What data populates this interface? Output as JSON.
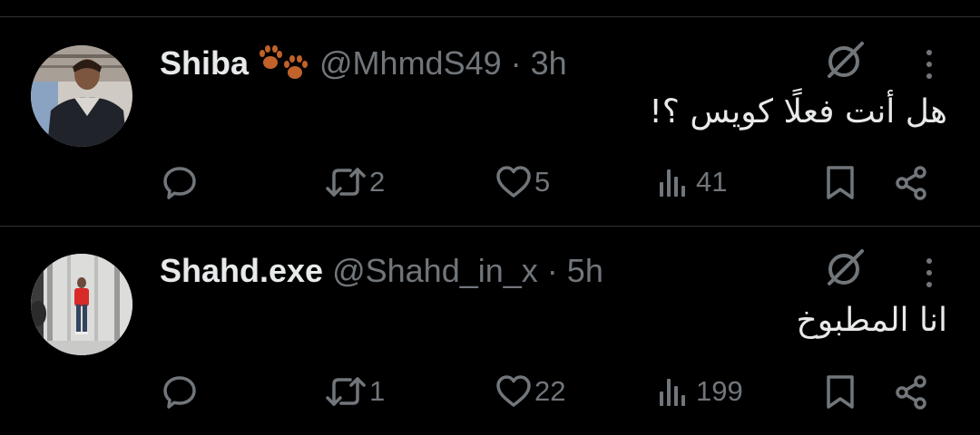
{
  "tweets": [
    {
      "name": "Shiba",
      "name_icon": "paw-prints-icon",
      "handle": "@MhmdS49",
      "separator": "·",
      "time": "3h",
      "text": "هل أنت فعلًا كويس ؟!",
      "replies": "",
      "retweets": "2",
      "likes": "5",
      "views": "41"
    },
    {
      "name": "Shahd.exe",
      "handle": "@Shahd_in_x",
      "separator": "·",
      "time": "5h",
      "text": "انا المطبوخ",
      "replies": "",
      "retweets": "1",
      "likes": "22",
      "views": "199"
    }
  ],
  "colors": {
    "background": "#000000",
    "primary_text": "#e7e9ea",
    "secondary_text": "#71767b",
    "divider": "#2f3336",
    "paw": "#c0622a"
  }
}
